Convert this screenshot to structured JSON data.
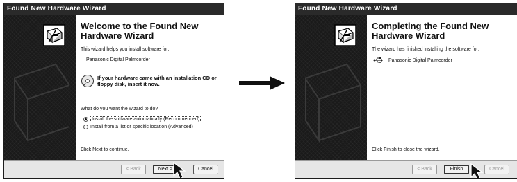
{
  "left_window": {
    "title": "Found New Hardware Wizard",
    "heading": "Welcome to the Found New Hardware Wizard",
    "intro": "This wizard helps you install software for:",
    "device": "Panasonic Digital Palmcorder",
    "cd_prompt": "If your hardware came with an installation CD or floppy disk, insert it now.",
    "question": "What do you want the wizard to do?",
    "options": [
      {
        "label": "Install the software automatically (Recommended)",
        "selected": true
      },
      {
        "label": "Install from a list or specific location (Advanced)",
        "selected": false
      }
    ],
    "continue_text": "Click Next to continue.",
    "buttons": {
      "back": "< Back",
      "next": "Next >",
      "cancel": "Cancel"
    }
  },
  "right_window": {
    "title": "Found New Hardware Wizard",
    "heading": "Completing the Found New Hardware Wizard",
    "intro": "The wizard has finished installing the software for:",
    "device": "Panasonic Digital Palmcorder",
    "finish_text": "Click Finish to close the wizard.",
    "buttons": {
      "back": "< Back",
      "finish": "Finish",
      "cancel": "Cancel"
    }
  },
  "icons": {
    "hardware": "hardware-wizard-icon",
    "cd": "cd-icon",
    "usb": "usb-icon",
    "cursor": "mouse-pointer-icon",
    "transition": "right-arrow-icon"
  },
  "colors": {
    "titlebar": "#2a2a2a",
    "sidebar": "#1a1a1a",
    "footer": "#e6e6e6"
  }
}
